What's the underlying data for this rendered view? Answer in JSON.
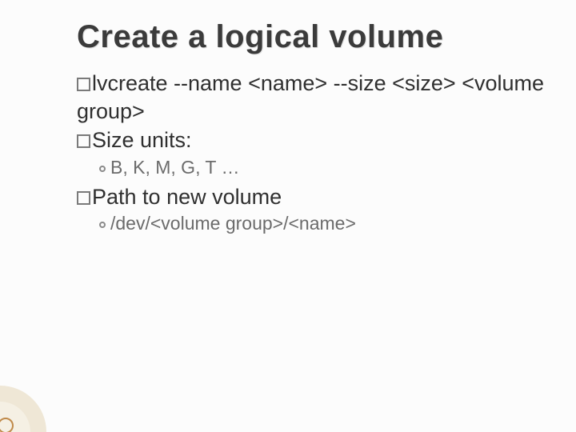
{
  "title": "Create a logical volume",
  "items": [
    {
      "text": "lvcreate  --name <name>  --size <size>  <volume group>"
    },
    {
      "text": "Size units:",
      "sub": "B, K, M, G, T …"
    },
    {
      "text": "Path to new volume",
      "sub": "/dev/<volume group>/<name>"
    }
  ]
}
